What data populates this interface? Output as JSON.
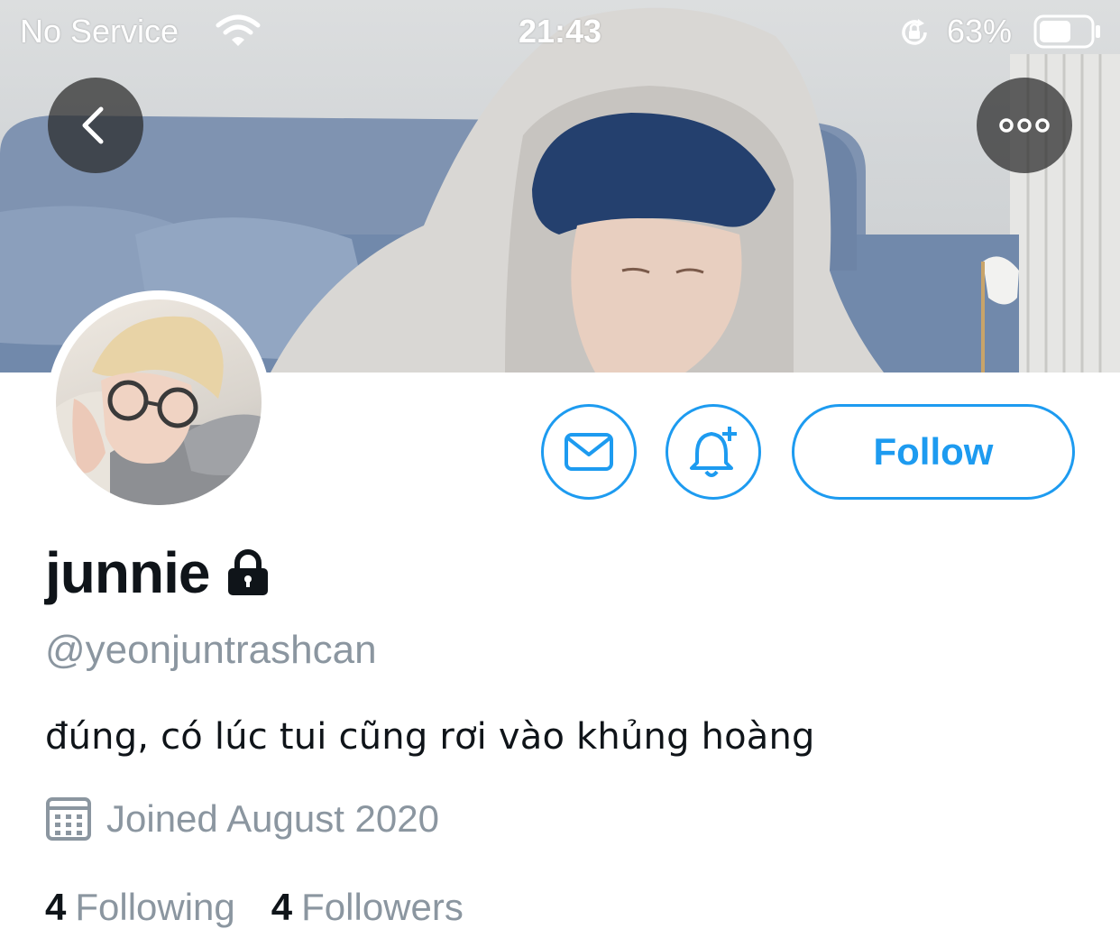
{
  "status_bar": {
    "carrier": "No Service",
    "time": "21:43",
    "battery_percent": "63%",
    "battery_level": 0.63,
    "icons": [
      "wifi-icon",
      "rotation-lock-icon",
      "battery-icon"
    ]
  },
  "header": {
    "back_icon": "chevron-left-icon",
    "more_icon": "more-horizontal-icon"
  },
  "actions": {
    "message_icon": "mail-icon",
    "notify_icon": "bell-plus-icon",
    "follow_label": "Follow"
  },
  "profile": {
    "display_name": "junnie",
    "protected_icon": "lock-icon",
    "handle": "@yeonjuntrashcan",
    "bio": "đúng, có lúc tui cũng rơi vào khủng hoàng",
    "joined_icon": "calendar-icon",
    "joined": "Joined August 2020",
    "following_count": "4",
    "following_label": "Following",
    "followers_count": "4",
    "followers_label": "Followers"
  },
  "colors": {
    "accent": "#1d9bf0",
    "muted_text": "#8b96a0",
    "primary_text": "#0f1419"
  }
}
